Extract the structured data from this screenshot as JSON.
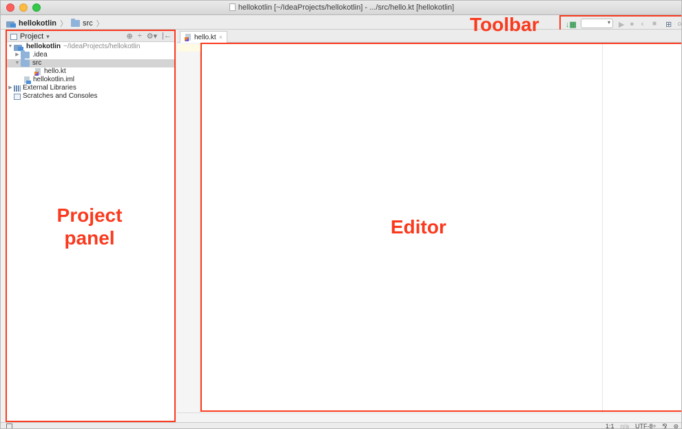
{
  "window": {
    "title": "hellokotlin [~/IdeaProjects/hellokotlin] - .../src/hello.kt [hellokotlin]"
  },
  "breadcrumb": {
    "project": "hellokotlin",
    "folder": "src"
  },
  "annotations": {
    "toolbar": "Toolbar",
    "project_panel_line1": "Project",
    "project_panel_line2": "panel",
    "editor": "Editor"
  },
  "toolbar": {
    "icons": [
      "build-icon",
      "run-config-dropdown",
      "run-icon",
      "debug-icon",
      "coverage-icon",
      "stop-icon",
      "project-structure-icon",
      "search-icon"
    ],
    "run_config_value": ""
  },
  "project_panel": {
    "view_label": "Project",
    "dropdown_glyph": "▾",
    "tools": [
      "⊕",
      "÷",
      "⚙▾",
      "|←"
    ],
    "tree": {
      "root_name": "hellokotlin",
      "root_path": "~/IdeaProjects/hellokotlin",
      "idea_folder": ".idea",
      "src_folder": "src",
      "hello_file": "hello.kt",
      "iml_file": "hellokotlin.iml",
      "external_libraries": "External Libraries",
      "scratches": "Scratches and Consoles"
    }
  },
  "editor": {
    "tab_label": "hello.kt",
    "tab_close": "×"
  },
  "status_bar": {
    "position": "1:1",
    "line_separator": "n/a",
    "encoding": "UTF-8÷",
    "lock": "⅋",
    "inspector": "⊜"
  },
  "colors": {
    "annotation": "#fa3a1e",
    "selection": "#d4d4d4",
    "folder": "#8fb3d9"
  }
}
